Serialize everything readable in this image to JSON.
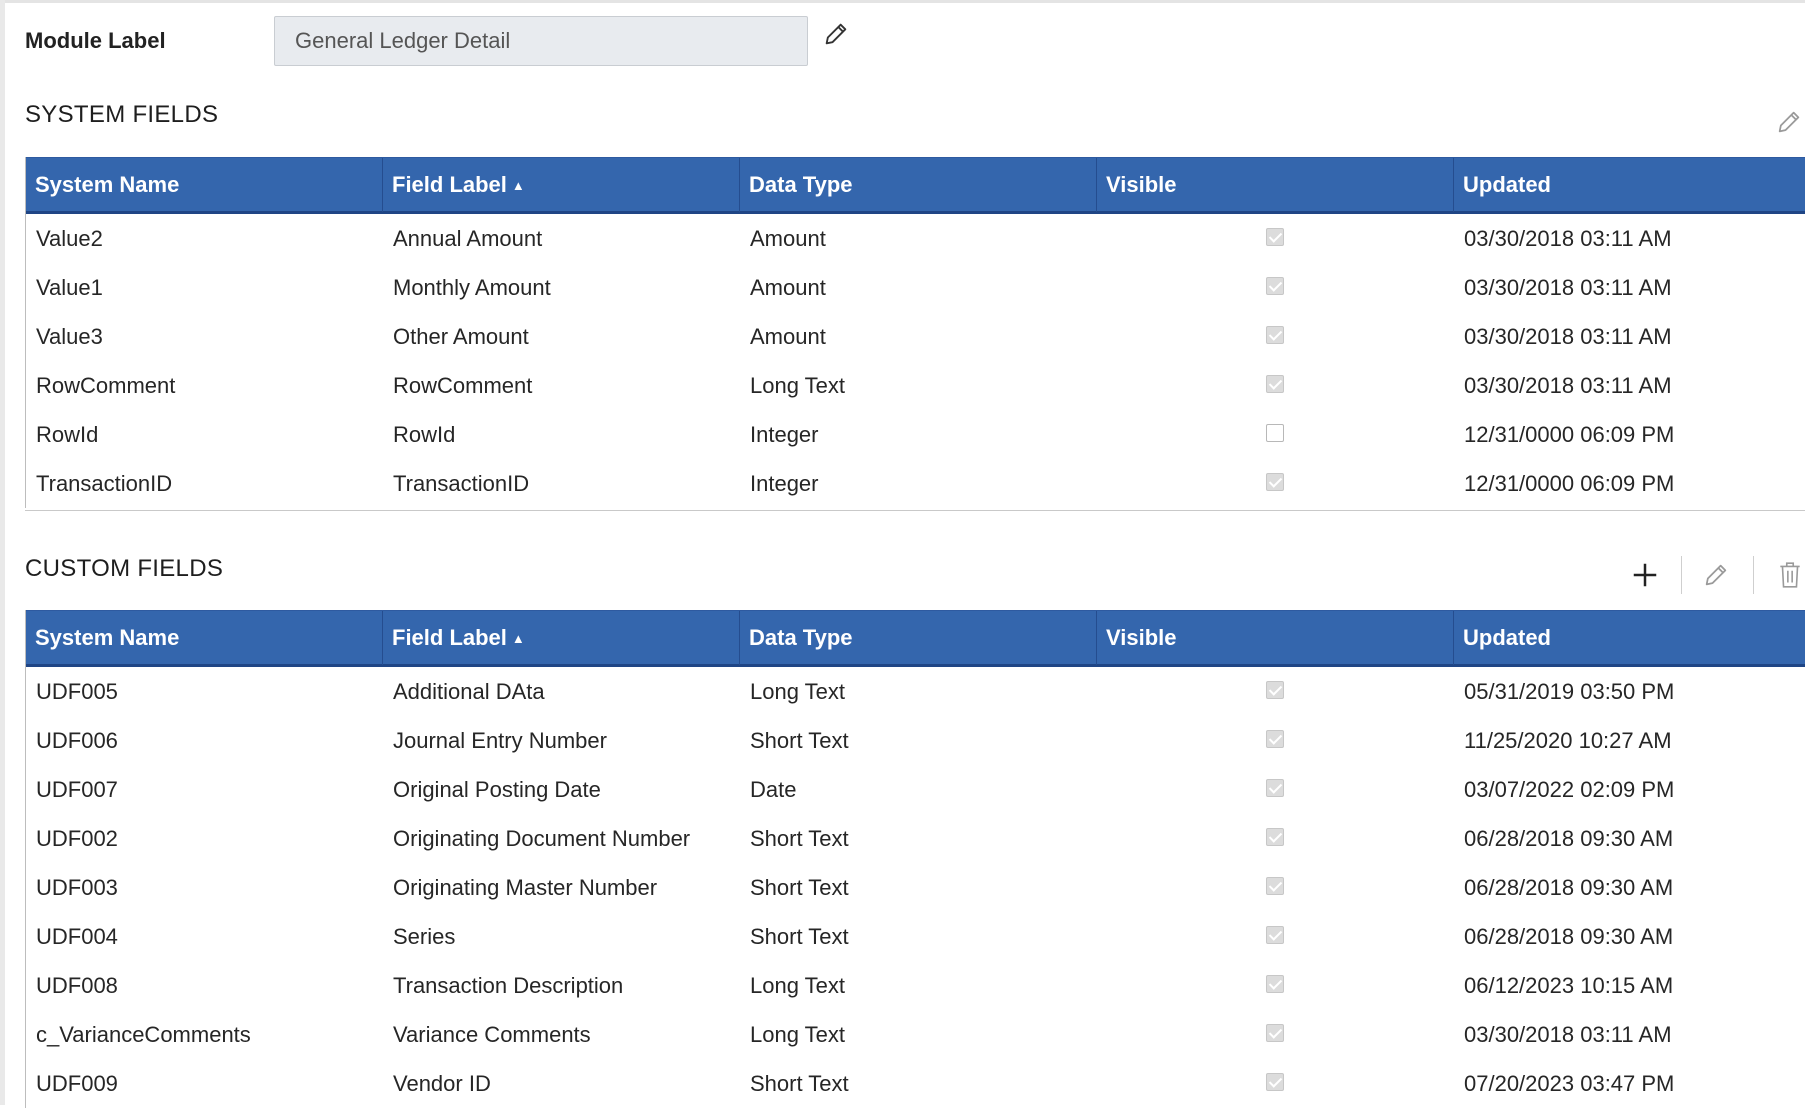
{
  "module": {
    "label": "Module Label",
    "value": "General Ledger Detail"
  },
  "system_fields": {
    "title": "SYSTEM FIELDS",
    "columns": [
      "System Name",
      "Field Label",
      "Data Type",
      "Visible",
      "Updated"
    ],
    "sorted_column": "Field Label",
    "sort_direction": "ascending",
    "rows": [
      {
        "system_name": "Value2",
        "field_label": "Annual Amount",
        "data_type": "Amount",
        "visible": true,
        "updated": "03/30/2018 03:11 AM"
      },
      {
        "system_name": "Value1",
        "field_label": "Monthly Amount",
        "data_type": "Amount",
        "visible": true,
        "updated": "03/30/2018 03:11 AM"
      },
      {
        "system_name": "Value3",
        "field_label": "Other Amount",
        "data_type": "Amount",
        "visible": true,
        "updated": "03/30/2018 03:11 AM"
      },
      {
        "system_name": "RowComment",
        "field_label": "RowComment",
        "data_type": "Long Text",
        "visible": true,
        "updated": "03/30/2018 03:11 AM"
      },
      {
        "system_name": "RowId",
        "field_label": "RowId",
        "data_type": "Integer",
        "visible": false,
        "updated": "12/31/0000 06:09 PM"
      },
      {
        "system_name": "TransactionID",
        "field_label": "TransactionID",
        "data_type": "Integer",
        "visible": true,
        "updated": "12/31/0000 06:09 PM"
      }
    ]
  },
  "custom_fields": {
    "title": "CUSTOM FIELDS",
    "columns": [
      "System Name",
      "Field Label",
      "Data Type",
      "Visible",
      "Updated"
    ],
    "sorted_column": "Field Label",
    "sort_direction": "ascending",
    "rows": [
      {
        "system_name": "UDF005",
        "field_label": "Additional DAta",
        "data_type": "Long Text",
        "visible": true,
        "updated": "05/31/2019 03:50 PM"
      },
      {
        "system_name": "UDF006",
        "field_label": "Journal Entry Number",
        "data_type": "Short Text",
        "visible": true,
        "updated": "11/25/2020 10:27 AM"
      },
      {
        "system_name": "UDF007",
        "field_label": "Original Posting Date",
        "data_type": "Date",
        "visible": true,
        "updated": "03/07/2022 02:09 PM"
      },
      {
        "system_name": "UDF002",
        "field_label": "Originating Document Number",
        "data_type": "Short Text",
        "visible": true,
        "updated": "06/28/2018 09:30 AM"
      },
      {
        "system_name": "UDF003",
        "field_label": "Originating Master Number",
        "data_type": "Short Text",
        "visible": true,
        "updated": "06/28/2018 09:30 AM"
      },
      {
        "system_name": "UDF004",
        "field_label": "Series",
        "data_type": "Short Text",
        "visible": true,
        "updated": "06/28/2018 09:30 AM"
      },
      {
        "system_name": "UDF008",
        "field_label": "Transaction Description",
        "data_type": "Long Text",
        "visible": true,
        "updated": "06/12/2023 10:15 AM"
      },
      {
        "system_name": "c_VarianceComments",
        "field_label": "Variance Comments",
        "data_type": "Long Text",
        "visible": true,
        "updated": "03/30/2018 03:11 AM"
      },
      {
        "system_name": "UDF009",
        "field_label": "Vendor ID",
        "data_type": "Short Text",
        "visible": true,
        "updated": "07/20/2023 03:47 PM"
      }
    ]
  },
  "icons": {
    "module_edit": "pencil-icon",
    "system_edit": "pencil-icon",
    "custom_add": "plus-icon",
    "custom_edit": "pencil-icon",
    "custom_delete": "trash-icon"
  },
  "colors": {
    "header_bg": "#3466ad",
    "header_text": "#ffffff"
  }
}
